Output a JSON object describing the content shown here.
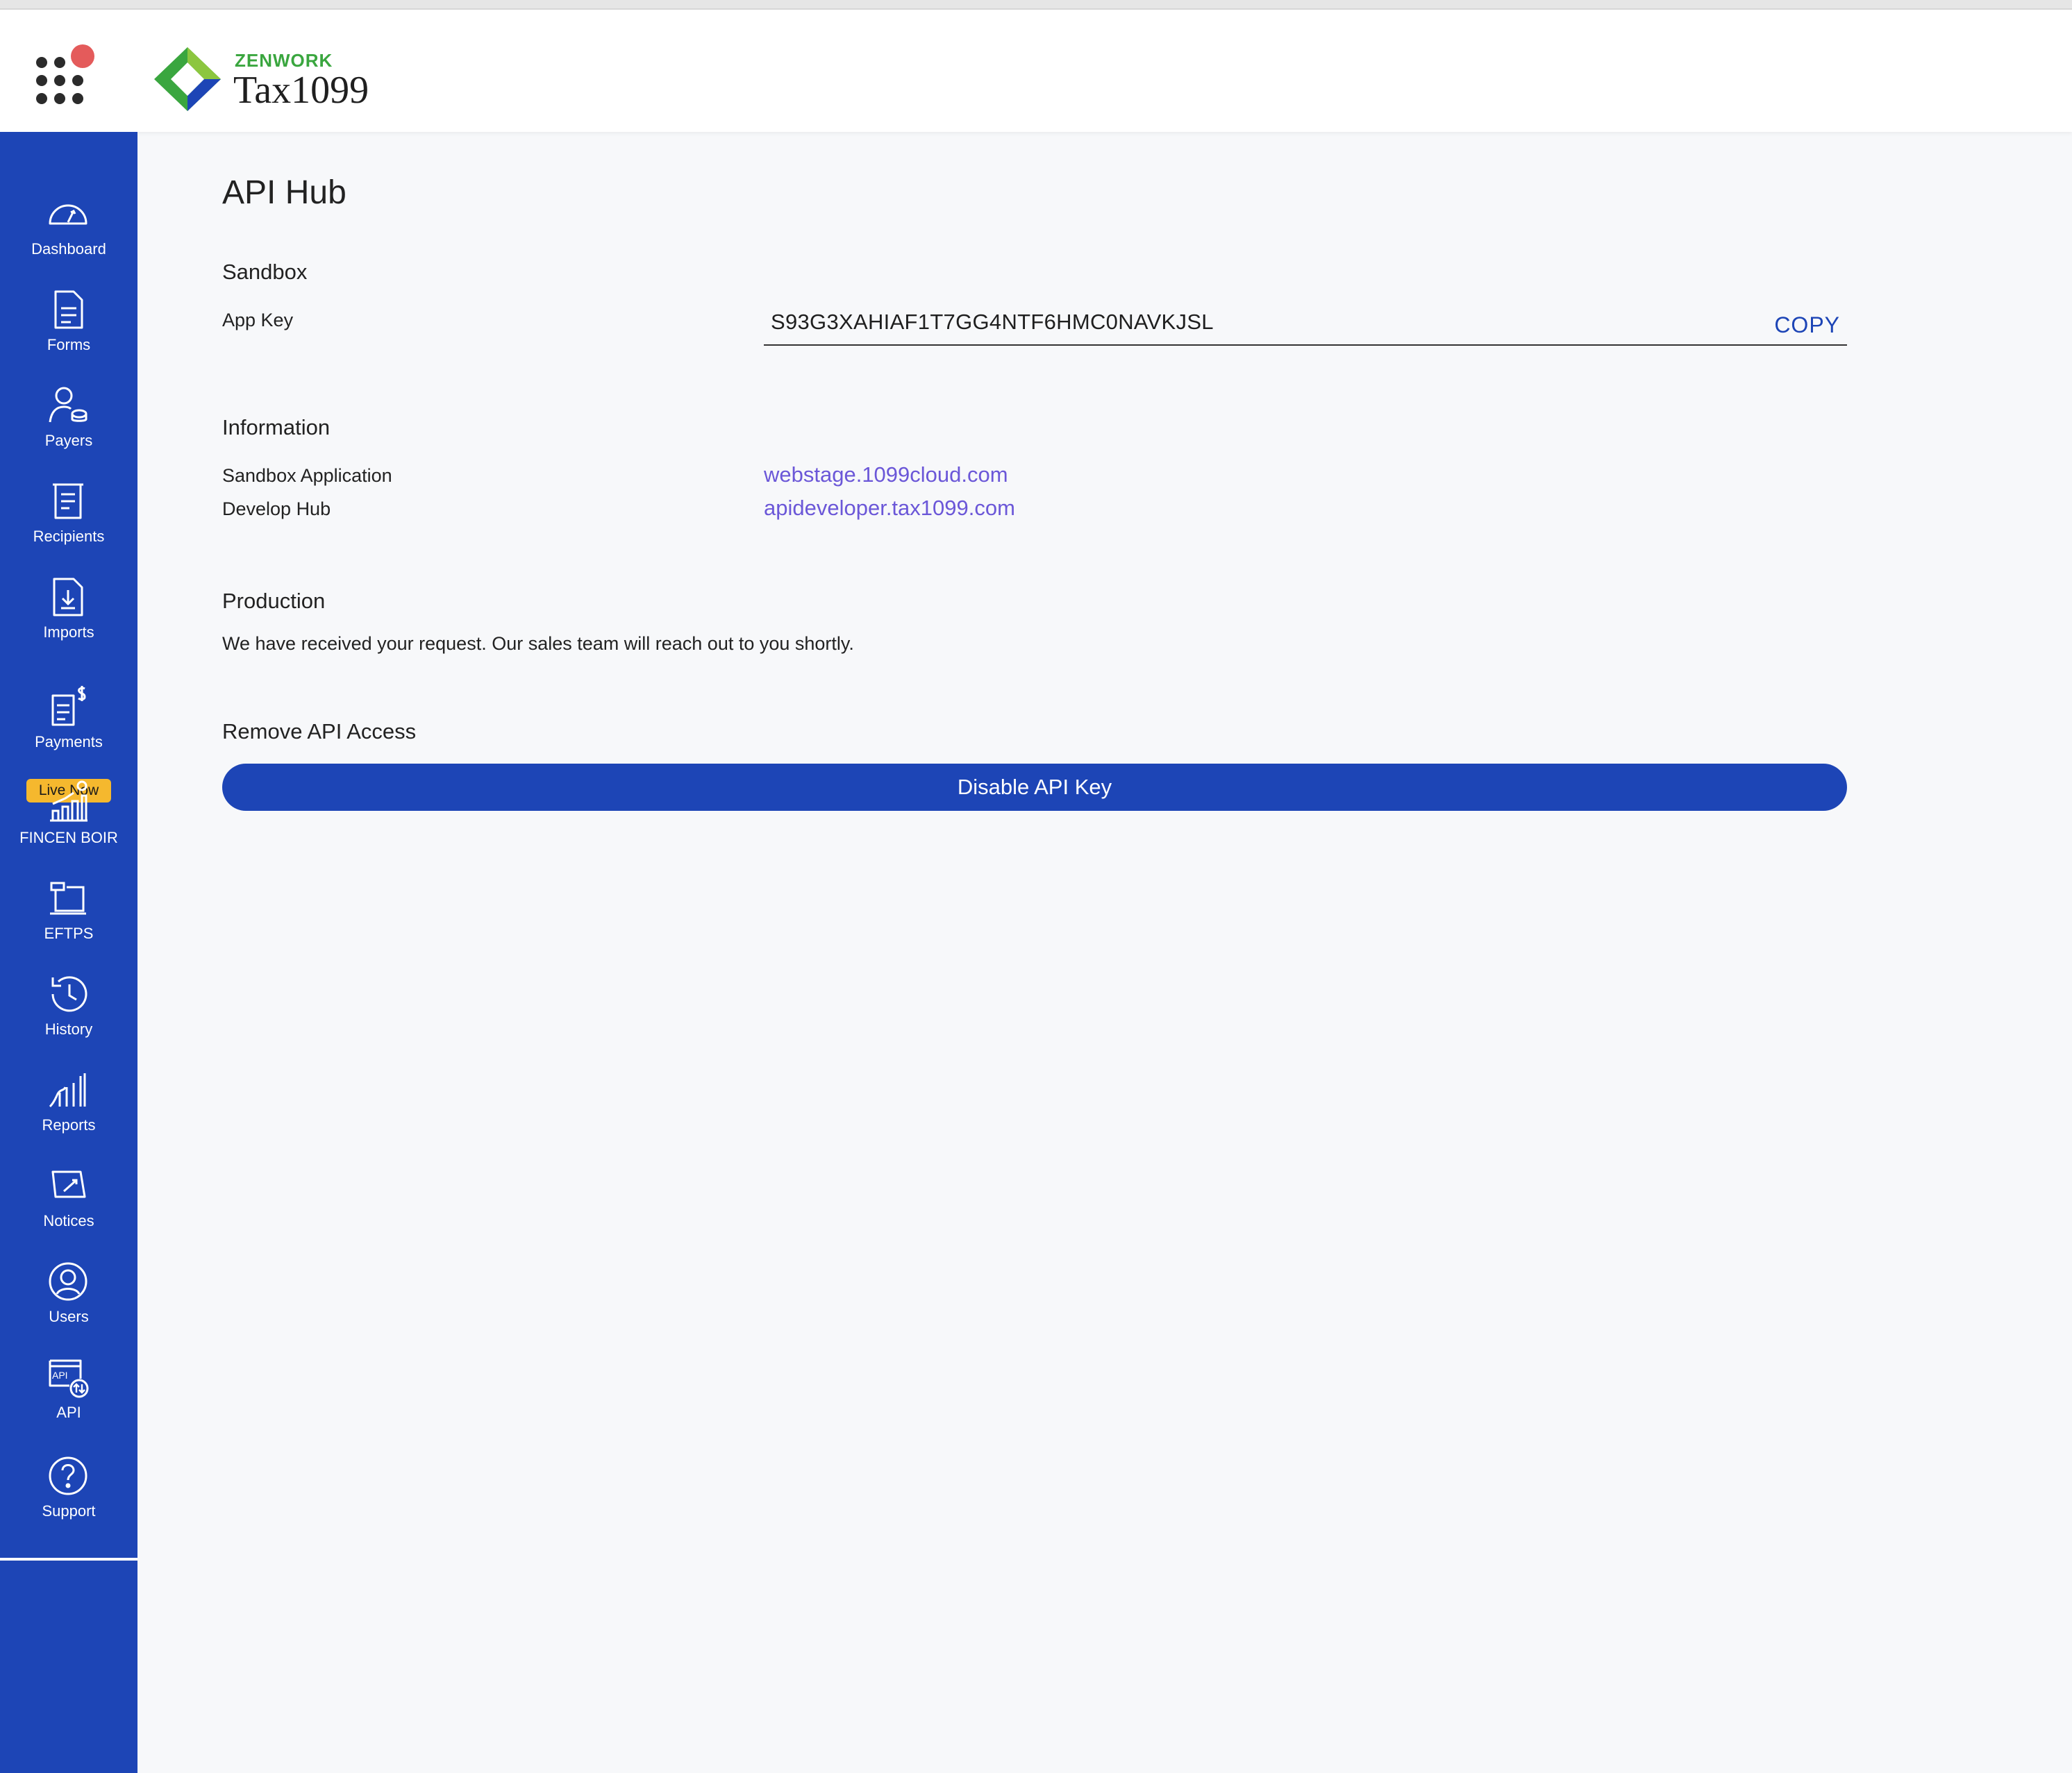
{
  "header": {
    "brand": "ZENWORK",
    "product": "Tax1099",
    "colors": {
      "brand_green": "#3aa63f",
      "brand_blue": "#1d45b6",
      "notification": "#e45b5b"
    }
  },
  "sidebar": {
    "background": "#1d45b6",
    "badge": "Live Now",
    "items": [
      {
        "label": "Dashboard",
        "icon": "dashboard-gauge-icon"
      },
      {
        "label": "Forms",
        "icon": "document-icon"
      },
      {
        "label": "Payers",
        "icon": "payer-user-coins-icon"
      },
      {
        "label": "Recipients",
        "icon": "receipt-icon"
      },
      {
        "label": "Imports",
        "icon": "import-download-icon"
      },
      {
        "label": "Payments",
        "icon": "payments-dollar-icon"
      },
      {
        "label": "FINCEN BOIR",
        "icon": "fincen-chart-icon"
      },
      {
        "label": "EFTPS",
        "icon": "eftps-terminal-icon"
      },
      {
        "label": "History",
        "icon": "history-clock-icon"
      },
      {
        "label": "Reports",
        "icon": "reports-chart-icon"
      },
      {
        "label": "Notices",
        "icon": "notices-icon"
      },
      {
        "label": "Users",
        "icon": "users-icon"
      },
      {
        "label": "API",
        "icon": "api-icon"
      },
      {
        "label": "Support",
        "icon": "support-question-icon"
      }
    ]
  },
  "main": {
    "title": "API Hub",
    "sandbox": {
      "title": "Sandbox",
      "app_key_label": "App Key",
      "app_key_value": "S93G3XAHIAF1T7GG4NTF6HMC0NAVKJSL",
      "copy_label": "COPY"
    },
    "information": {
      "title": "Information",
      "rows": [
        {
          "label": "Sandbox Application",
          "value": "webstage.1099cloud.com"
        },
        {
          "label": "Develop Hub",
          "value": "apideveloper.tax1099.com"
        }
      ]
    },
    "production": {
      "title": "Production",
      "message": "We have received your request. Our sales team will reach out to you shortly."
    },
    "remove": {
      "title": "Remove API Access",
      "button_label": "Disable API Key"
    }
  }
}
